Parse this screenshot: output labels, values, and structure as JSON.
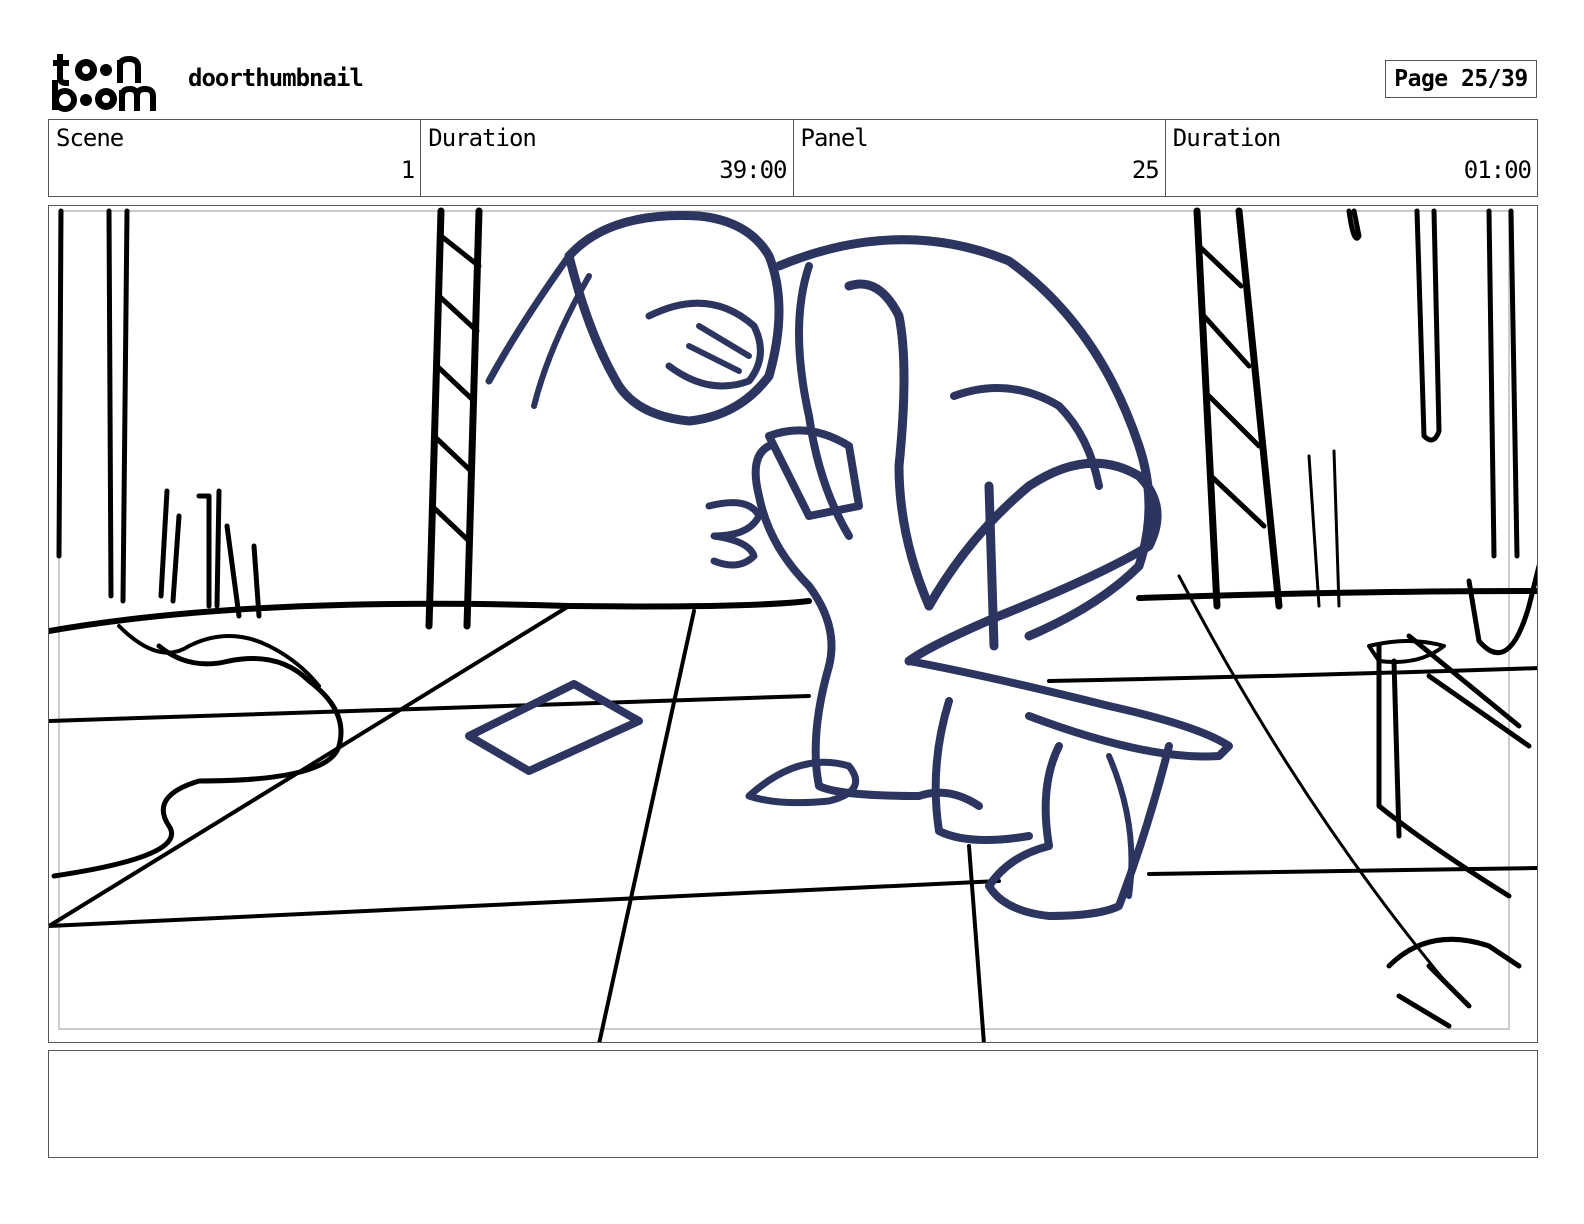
{
  "header": {
    "logo": {
      "icon": "toon-boom-logo",
      "line1": "toon",
      "line2": "boom"
    },
    "project_title": "doorthumbnail",
    "page_indicator": "Page 25/39"
  },
  "info": {
    "scene_label": "Scene",
    "scene_value": "1",
    "scene_duration_label": "Duration",
    "scene_duration_value": "39:00",
    "panel_label": "Panel",
    "panel_value": "25",
    "panel_duration_label": "Duration",
    "panel_duration_value": "01:00"
  },
  "panel": {
    "image": "storyboard-sketch-figure-crouching-on-tiled-floor",
    "figure_color": "#2c3560",
    "line_color": "#000000"
  },
  "notes": {
    "text": ""
  }
}
